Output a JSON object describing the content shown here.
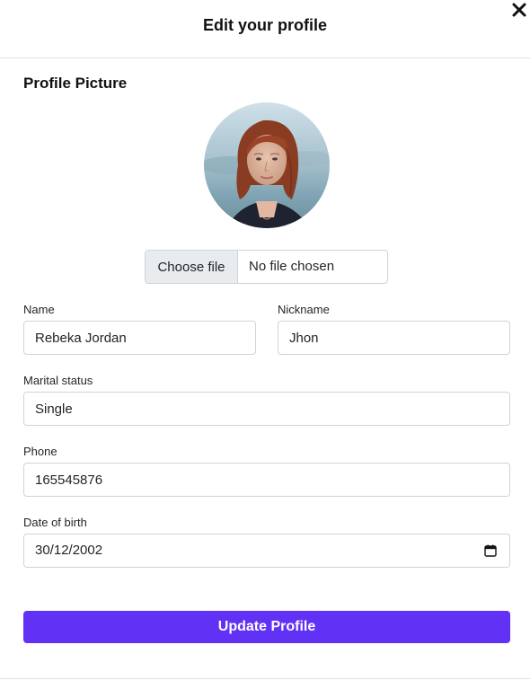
{
  "header": {
    "title": "Edit your profile",
    "close_icon": "close-icon"
  },
  "profile_picture": {
    "section_title": "Profile Picture",
    "file_button_label": "Choose file",
    "file_status": "No file chosen"
  },
  "form": {
    "name": {
      "label": "Name",
      "value": "Rebeka Jordan"
    },
    "nickname": {
      "label": "Nickname",
      "value": "Jhon"
    },
    "marital_status": {
      "label": "Marital status",
      "value": "Single"
    },
    "phone": {
      "label": "Phone",
      "value": "165545876"
    },
    "date_of_birth": {
      "label": "Date of birth",
      "value": "30/12/2002",
      "icon": "calendar-icon"
    }
  },
  "submit": {
    "label": "Update Profile",
    "color": "#6131f6"
  }
}
